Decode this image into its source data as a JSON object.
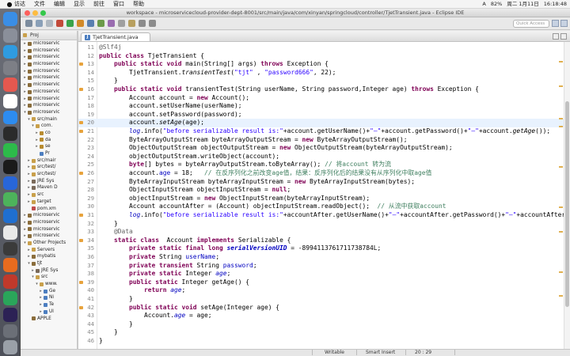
{
  "menubar": {
    "apple": "",
    "items": [
      "访达",
      "文件",
      "编辑",
      "显示",
      "前往",
      "窗口",
      "帮助"
    ],
    "status": [
      "82%",
      "周二 1月11日",
      "16:18:48"
    ],
    "input_method_label": "A"
  },
  "window": {
    "title": "workspace - microservicecloud-provider-dept-8001/src/main/java/com/xinyan/springcloud/controller/TjetTransient.java - Eclipse IDE",
    "quick_access_placeholder": "Quick Access"
  },
  "project_explorer": {
    "title": "Proj",
    "rows": [
      {
        "indent": 0,
        "arrow": "▸",
        "label": "microservic",
        "color": "#8a6d3b"
      },
      {
        "indent": 0,
        "arrow": "▸",
        "label": "microservic",
        "color": "#8a6d3b"
      },
      {
        "indent": 0,
        "arrow": "▸",
        "label": "microservic",
        "color": "#8a6d3b"
      },
      {
        "indent": 0,
        "arrow": "▸",
        "label": "microservic",
        "color": "#8a6d3b"
      },
      {
        "indent": 0,
        "arrow": "▸",
        "label": "microservic",
        "color": "#8a6d3b"
      },
      {
        "indent": 0,
        "arrow": "▸",
        "label": "microservic",
        "color": "#8a6d3b"
      },
      {
        "indent": 0,
        "arrow": "▸",
        "label": "microservic",
        "color": "#8a6d3b"
      },
      {
        "indent": 0,
        "arrow": "▸",
        "label": "microservic",
        "color": "#8a6d3b"
      },
      {
        "indent": 0,
        "arrow": "▸",
        "label": "microservic",
        "color": "#8a6d3b"
      },
      {
        "indent": 0,
        "arrow": "▸",
        "label": "microservic",
        "color": "#8a6d3b"
      },
      {
        "indent": 0,
        "arrow": "▾",
        "label": "microservic",
        "color": "#8a6d3b"
      },
      {
        "indent": 1,
        "arrow": "▾",
        "label": "src/main",
        "color": "#c9a04b"
      },
      {
        "indent": 2,
        "arrow": "▾",
        "label": "com.",
        "color": "#c9a04b"
      },
      {
        "indent": 3,
        "arrow": "▸",
        "label": "co",
        "color": "#b88b2e"
      },
      {
        "indent": 3,
        "arrow": "▸",
        "label": "da",
        "color": "#b88b2e"
      },
      {
        "indent": 3,
        "arrow": "▸",
        "label": "se",
        "color": "#b88b2e"
      },
      {
        "indent": 3,
        "arrow": "",
        "label": "Pr",
        "color": "#4c7ec0"
      },
      {
        "indent": 1,
        "arrow": "▸",
        "label": "src/mair",
        "color": "#c9a04b"
      },
      {
        "indent": 1,
        "arrow": "▸",
        "label": "src/test/",
        "color": "#c9a04b"
      },
      {
        "indent": 1,
        "arrow": "▸",
        "label": "src/test/",
        "color": "#c9a04b"
      },
      {
        "indent": 1,
        "arrow": "▸",
        "label": "JRE Sys",
        "color": "#7a6a5a"
      },
      {
        "indent": 1,
        "arrow": "▸",
        "label": "Maven D",
        "color": "#7a6a5a"
      },
      {
        "indent": 1,
        "arrow": "▸",
        "label": "src",
        "color": "#c9a04b"
      },
      {
        "indent": 1,
        "arrow": "▸",
        "label": "target",
        "color": "#c9a04b"
      },
      {
        "indent": 1,
        "arrow": "",
        "label": "pom.xm",
        "color": "#c04b4b"
      },
      {
        "indent": 0,
        "arrow": "▸",
        "label": "microservic",
        "color": "#8a6d3b"
      },
      {
        "indent": 0,
        "arrow": "▸",
        "label": "microservic",
        "color": "#8a6d3b"
      },
      {
        "indent": 0,
        "arrow": "▸",
        "label": "microservic",
        "color": "#8a6d3b"
      },
      {
        "indent": 0,
        "arrow": "▸",
        "label": "microservic",
        "color": "#8a6d3b"
      },
      {
        "indent": 0,
        "arrow": "▾",
        "label": "Other Projects",
        "color": "#c9a04b"
      },
      {
        "indent": 1,
        "arrow": "▸",
        "label": "Servers",
        "color": "#c9a04b"
      },
      {
        "indent": 1,
        "arrow": "▸",
        "label": "mybatis",
        "color": "#8a6d3b"
      },
      {
        "indent": 1,
        "arrow": "▾",
        "label": "tjt",
        "color": "#8a6d3b"
      },
      {
        "indent": 2,
        "arrow": "▸",
        "label": "JRE Sys",
        "color": "#7a6a5a"
      },
      {
        "indent": 2,
        "arrow": "▾",
        "label": "src",
        "color": "#c9a04b"
      },
      {
        "indent": 3,
        "arrow": "▾",
        "label": "www.",
        "color": "#c9a04b"
      },
      {
        "indent": 4,
        "arrow": "▸",
        "label": "Ge",
        "color": "#4c7ec0"
      },
      {
        "indent": 4,
        "arrow": "▸",
        "label": "Ni",
        "color": "#4c7ec0"
      },
      {
        "indent": 4,
        "arrow": "▸",
        "label": "Te",
        "color": "#4c7ec0"
      },
      {
        "indent": 4,
        "arrow": "▸",
        "label": "Ul",
        "color": "#4c7ec0"
      },
      {
        "indent": 1,
        "arrow": "",
        "label": "APPLE",
        "color": "#8a6d3b"
      }
    ]
  },
  "editor": {
    "tab_label": "TjetTransient.java",
    "tab_icon": "J",
    "highlight_line": 20,
    "lines": [
      {
        "n": "11",
        "mark": false,
        "segs": [
          [
            "ann",
            "@Slf4j"
          ]
        ]
      },
      {
        "n": "12",
        "mark": false,
        "segs": [
          [
            "kw",
            "public class "
          ],
          [
            "",
            "TjetTransient {"
          ]
        ]
      },
      {
        "n": "13",
        "mark": true,
        "segs": [
          [
            "",
            "    "
          ],
          [
            "kw",
            "public static void "
          ],
          [
            "",
            "main(String[] args) "
          ],
          [
            "kw",
            "throws "
          ],
          [
            "",
            "Exception {"
          ]
        ]
      },
      {
        "n": "14",
        "mark": false,
        "segs": [
          [
            "",
            "        TjetTransient."
          ],
          [
            "it",
            "transientTest"
          ],
          [
            "",
            "("
          ],
          [
            "str",
            "\"tjt\""
          ],
          [
            "",
            " , "
          ],
          [
            "str",
            "\"password666\""
          ],
          [
            "",
            ", 22);"
          ]
        ]
      },
      {
        "n": "15",
        "mark": false,
        "segs": [
          [
            "",
            "    }"
          ]
        ]
      },
      {
        "n": "16",
        "mark": true,
        "segs": [
          [
            "",
            "    "
          ],
          [
            "kw",
            "public static void "
          ],
          [
            "",
            "transientTest(String userName, String password,Integer age) "
          ],
          [
            "kw",
            "throws "
          ],
          [
            "",
            "Exception {"
          ]
        ]
      },
      {
        "n": "17",
        "mark": false,
        "segs": [
          [
            "",
            "        Account account = "
          ],
          [
            "kw",
            "new "
          ],
          [
            "",
            "Account();"
          ]
        ]
      },
      {
        "n": "18",
        "mark": false,
        "segs": [
          [
            "",
            "        account.setUserName(userName);"
          ]
        ]
      },
      {
        "n": "19",
        "mark": false,
        "segs": [
          [
            "",
            "        account.setPassword(password);"
          ]
        ]
      },
      {
        "n": "20",
        "mark": true,
        "segs": [
          [
            "",
            "        account."
          ],
          [
            "it",
            "setAge"
          ],
          [
            "",
            "(age);"
          ]
        ]
      },
      {
        "n": "21",
        "mark": true,
        "segs": [
          [
            "",
            "        "
          ],
          [
            "sfld",
            "log"
          ],
          [
            "",
            ".info("
          ],
          [
            "str",
            "\"before serializable result is:\""
          ],
          [
            "",
            "+account.getUserName()+"
          ],
          [
            "str",
            "\"—\""
          ],
          [
            "",
            "+account.getPassword()+"
          ],
          [
            "str",
            "\"—\""
          ],
          [
            "",
            "+account."
          ],
          [
            "it",
            "getAge"
          ],
          [
            "",
            "());"
          ]
        ]
      },
      {
        "n": "22",
        "mark": false,
        "segs": [
          [
            "",
            "        ByteArrayOutputStream byteArrayOutputStream = "
          ],
          [
            "kw",
            "new "
          ],
          [
            "",
            "ByteArrayOutputStream();"
          ]
        ]
      },
      {
        "n": "23",
        "mark": false,
        "segs": [
          [
            "",
            "        ObjectOutputStream objectOutputStream = "
          ],
          [
            "kw",
            "new "
          ],
          [
            "",
            "ObjectOutputStream(byteArrayOutputStream);"
          ]
        ]
      },
      {
        "n": "24",
        "mark": false,
        "segs": [
          [
            "",
            "        objectOutputStream.writeObject(account);"
          ]
        ]
      },
      {
        "n": "25",
        "mark": false,
        "segs": [
          [
            "",
            "        "
          ],
          [
            "kw",
            "byte"
          ],
          [
            "",
            "[] bytes = byteArrayOutputStream.toByteArray(); "
          ],
          [
            "cmt",
            "// 将account 转为流"
          ]
        ]
      },
      {
        "n": "26",
        "mark": true,
        "segs": [
          [
            "",
            "        account."
          ],
          [
            "fld",
            "age"
          ],
          [
            "",
            " = 18;   "
          ],
          [
            "cmt",
            "// 在反序列化之前改变age值，结果：反序列化后的结果没有从序列化中取age值"
          ]
        ]
      },
      {
        "n": "27",
        "mark": false,
        "segs": [
          [
            "",
            "        ByteArrayInputStream byteArrayInputStream = "
          ],
          [
            "kw",
            "new "
          ],
          [
            "",
            "ByteArrayInputStream(bytes);"
          ]
        ]
      },
      {
        "n": "28",
        "mark": false,
        "segs": [
          [
            "",
            "        ObjectInputStream objectInputStream = "
          ],
          [
            "kw",
            "null"
          ],
          [
            "",
            ";"
          ]
        ]
      },
      {
        "n": "29",
        "mark": false,
        "segs": [
          [
            "",
            "        objectInputStream = "
          ],
          [
            "kw",
            "new "
          ],
          [
            "",
            "ObjectInputStream(byteArrayInputStream);"
          ]
        ]
      },
      {
        "n": "30",
        "mark": false,
        "segs": [
          [
            "",
            "        Account accountAfter = (Account) objectInputStream.readObject();  "
          ],
          [
            "cmt",
            "// 从流中获取account"
          ]
        ]
      },
      {
        "n": "31",
        "mark": true,
        "segs": [
          [
            "",
            "        "
          ],
          [
            "sfld",
            "log"
          ],
          [
            "",
            ".info("
          ],
          [
            "str",
            "\"before serializable result is:\""
          ],
          [
            "",
            "+accountAfter.getUserName()+"
          ],
          [
            "str",
            "\"—\""
          ],
          [
            "",
            "+accountAfter.getPassword()+"
          ],
          [
            "str",
            "\"—\""
          ],
          [
            "",
            "+accountAfter"
          ]
        ]
      },
      {
        "n": "32",
        "mark": false,
        "segs": [
          [
            "",
            "    }"
          ]
        ]
      },
      {
        "n": "33",
        "mark": false,
        "segs": [
          [
            "",
            "    "
          ],
          [
            "ann",
            "@Data"
          ]
        ]
      },
      {
        "n": "34",
        "mark": true,
        "segs": [
          [
            "",
            "    "
          ],
          [
            "kw",
            "static class  "
          ],
          [
            "",
            "Account "
          ],
          [
            "kw",
            "implements "
          ],
          [
            "",
            "Serializable {"
          ]
        ]
      },
      {
        "n": "35",
        "mark": false,
        "segs": [
          [
            "",
            "        "
          ],
          [
            "kw",
            "private static final long "
          ],
          [
            "sfldb",
            "serialVersionUID"
          ],
          [
            "",
            " = -8994113761711738784L;"
          ]
        ]
      },
      {
        "n": "36",
        "mark": false,
        "segs": [
          [
            "",
            "        "
          ],
          [
            "kw",
            "private "
          ],
          [
            "",
            "String "
          ],
          [
            "fld",
            "userName"
          ],
          [
            "",
            ";"
          ]
        ]
      },
      {
        "n": "37",
        "mark": false,
        "segs": [
          [
            "",
            "        "
          ],
          [
            "kw",
            "private transient "
          ],
          [
            "",
            "String "
          ],
          [
            "fld",
            "password"
          ],
          [
            "",
            ";"
          ]
        ]
      },
      {
        "n": "38",
        "mark": false,
        "segs": [
          [
            "",
            "        "
          ],
          [
            "kw",
            "private static "
          ],
          [
            "",
            "Integer "
          ],
          [
            "sfld",
            "age"
          ],
          [
            "",
            ";"
          ]
        ]
      },
      {
        "n": "39",
        "mark": true,
        "segs": [
          [
            "",
            "        "
          ],
          [
            "kw",
            "public static "
          ],
          [
            "",
            "Integer getAge() {"
          ]
        ]
      },
      {
        "n": "40",
        "mark": false,
        "segs": [
          [
            "",
            "            "
          ],
          [
            "kw",
            "return "
          ],
          [
            "sfld",
            "age"
          ],
          [
            "",
            ";"
          ]
        ]
      },
      {
        "n": "41",
        "mark": false,
        "segs": [
          [
            "",
            "        }"
          ]
        ]
      },
      {
        "n": "42",
        "mark": true,
        "segs": [
          [
            "",
            "        "
          ],
          [
            "kw",
            "public static void "
          ],
          [
            "",
            "setAge(Integer age) {"
          ]
        ]
      },
      {
        "n": "43",
        "mark": false,
        "segs": [
          [
            "",
            "            Account."
          ],
          [
            "sfld",
            "age"
          ],
          [
            "",
            " = age;"
          ]
        ]
      },
      {
        "n": "44",
        "mark": false,
        "segs": [
          [
            "",
            "        }"
          ]
        ]
      },
      {
        "n": "45",
        "mark": false,
        "segs": [
          [
            "",
            "    }"
          ]
        ]
      },
      {
        "n": "46",
        "mark": false,
        "segs": [
          [
            "",
            "}"
          ]
        ]
      }
    ]
  },
  "statusbar": {
    "writable": "Writable",
    "insert_mode": "Smart Insert",
    "position": "20 : 29"
  },
  "dock_icons": [
    {
      "name": "finder-icon",
      "color": "#3a8ee6"
    },
    {
      "name": "launchpad-icon",
      "color": "#8a8f9a"
    },
    {
      "name": "safari-icon",
      "color": "#2f9be0"
    },
    {
      "name": "settings-icon",
      "color": "#7d7f86"
    },
    {
      "name": "photos-icon",
      "color": "#e5584f"
    },
    {
      "name": "calendar-icon",
      "color": "#ffffff"
    },
    {
      "name": "appstore-icon",
      "color": "#2d8cf0"
    },
    {
      "name": "terminal-icon",
      "color": "#2b2b2b"
    },
    {
      "name": "wechat-icon",
      "color": "#2dbb4a"
    },
    {
      "name": "qq-icon",
      "color": "#1b1b1b"
    },
    {
      "name": "app-k-icon",
      "color": "#2866d9"
    },
    {
      "name": "maps-icon",
      "color": "#4db35b"
    },
    {
      "name": "app-blue-icon",
      "color": "#1f6fd1"
    },
    {
      "name": "chrome-icon",
      "color": "#e9e9e9"
    },
    {
      "name": "sublime-icon",
      "color": "#3b3b3b"
    },
    {
      "name": "firefox-icon",
      "color": "#e86b1f"
    },
    {
      "name": "dictionary-icon",
      "color": "#c0392b"
    },
    {
      "name": "app-green-icon",
      "color": "#2aa55a"
    },
    {
      "name": "eclipse-icon",
      "color": "#2c2255"
    },
    {
      "name": "app-gray-icon",
      "color": "#6b6f77"
    },
    {
      "name": "trash-icon",
      "color": "#9aa0a8"
    }
  ]
}
